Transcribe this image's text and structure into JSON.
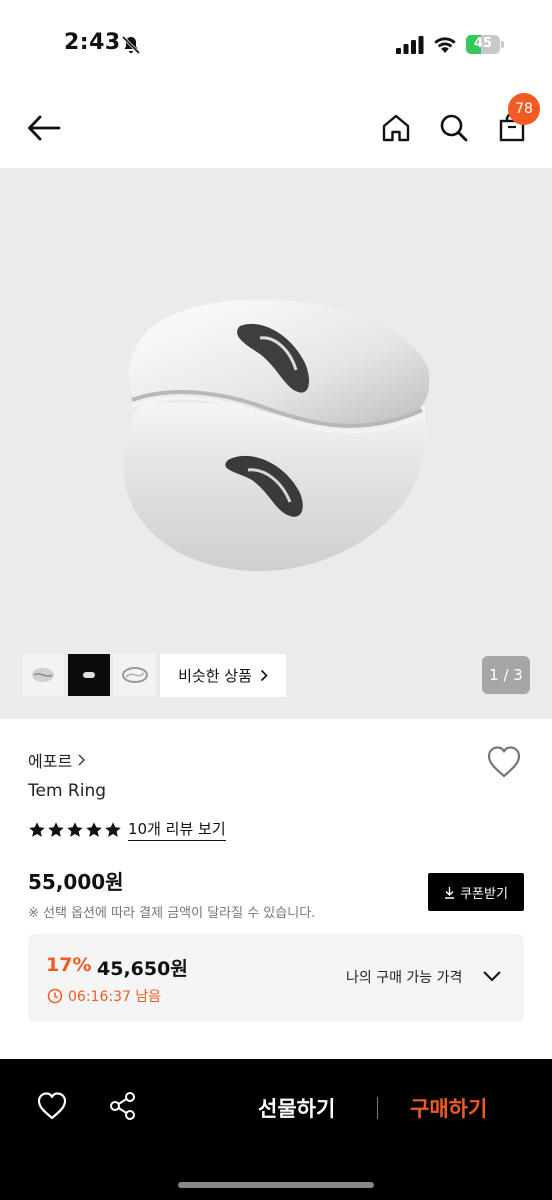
{
  "status_bar": {
    "time": "2:43",
    "battery_level": "45",
    "battery_percent": 45
  },
  "header": {
    "cart_count": "78"
  },
  "gallery": {
    "similar_products_label": "비슷한 상품",
    "page_indicator": "1 / 3"
  },
  "product": {
    "brand": "에포르",
    "name": "Tem Ring",
    "rating_stars": 5,
    "review_link": "10개 리뷰 보기",
    "price": "55,000원",
    "price_note": "※ 선택 옵션에 따라 결제 금액이 달라질 수 있습니다.",
    "coupon_label": "쿠폰받기"
  },
  "discount": {
    "rate": "17%",
    "price": "45,650원",
    "timer": "06:16:37 남음",
    "my_price_label": "나의 구매 가능 가격"
  },
  "bottom_bar": {
    "gift_label": "선물하기",
    "buy_label": "구매하기"
  },
  "colors": {
    "accent": "#f15a22",
    "image_background": "#ebebeb",
    "bottom_bar": "#000000"
  }
}
